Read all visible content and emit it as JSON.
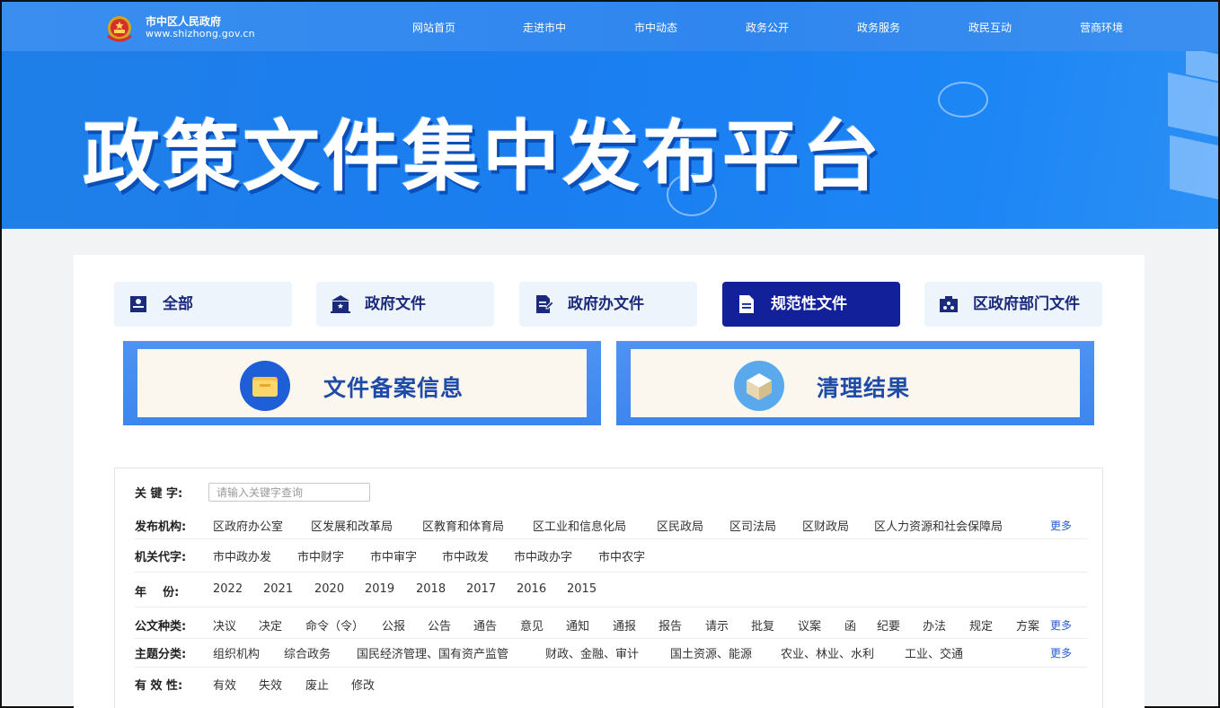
{
  "header": {
    "site_name": "市中区人民政府",
    "site_url": "www.shizhong.gov.cn",
    "nav": [
      "网站首页",
      "走进市中",
      "市中动态",
      "政务公开",
      "政务服务",
      "政民互动",
      "营商环境"
    ]
  },
  "banner": {
    "title": "政策文件集中发布平台"
  },
  "tabs": [
    {
      "label": "全部",
      "icon": "id-card-icon",
      "active": false
    },
    {
      "label": "政府文件",
      "icon": "government-building-icon",
      "active": false
    },
    {
      "label": "政府办文件",
      "icon": "document-edit-icon",
      "active": false
    },
    {
      "label": "规范性文件",
      "icon": "document-icon",
      "active": true
    },
    {
      "label": "区政府部门文件",
      "icon": "department-icon",
      "active": false
    }
  ],
  "cards": [
    {
      "label": "文件备案信息",
      "icon": "folder-icon"
    },
    {
      "label": "清理结果",
      "icon": "box-icon"
    }
  ],
  "filters": {
    "keyword": {
      "label": "关 键 字:",
      "placeholder": "请输入关键字查询"
    },
    "publisher": {
      "label": "发布机构:",
      "items": [
        "区政府办公室",
        "区发展和改革局",
        "区教育和体育局",
        "区工业和信息化局",
        "区民政局",
        "区司法局",
        "区财政局",
        "区人力资源和社会保障局"
      ],
      "more": "更多"
    },
    "code": {
      "label": "机关代字:",
      "items": [
        "市中政办发",
        "市中财字",
        "市中审字",
        "市中政发",
        "市中政办字",
        "市中农字"
      ]
    },
    "year": {
      "label": "年    份:",
      "items": [
        "2022",
        "2021",
        "2020",
        "2019",
        "2018",
        "2017",
        "2016",
        "2015"
      ]
    },
    "doc_type": {
      "label": "公文种类:",
      "items": [
        "决议",
        "决定",
        "命令（令）",
        "公报",
        "公告",
        "通告",
        "意见",
        "通知",
        "通报",
        "报告",
        "请示",
        "批复",
        "议案",
        "函",
        "纪要",
        "办法",
        "规定",
        "方案"
      ],
      "more": "更多"
    },
    "topic": {
      "label": "主题分类:",
      "items": [
        "组织机构",
        "综合政务",
        "国民经济管理、国有资产监管",
        "财政、金融、审计",
        "国土资源、能源",
        "农业、林业、水利",
        "工业、交通"
      ],
      "more": "更多"
    },
    "validity": {
      "label": "有 效 性:",
      "items": [
        "有效",
        "失效",
        "废止",
        "修改"
      ]
    }
  }
}
